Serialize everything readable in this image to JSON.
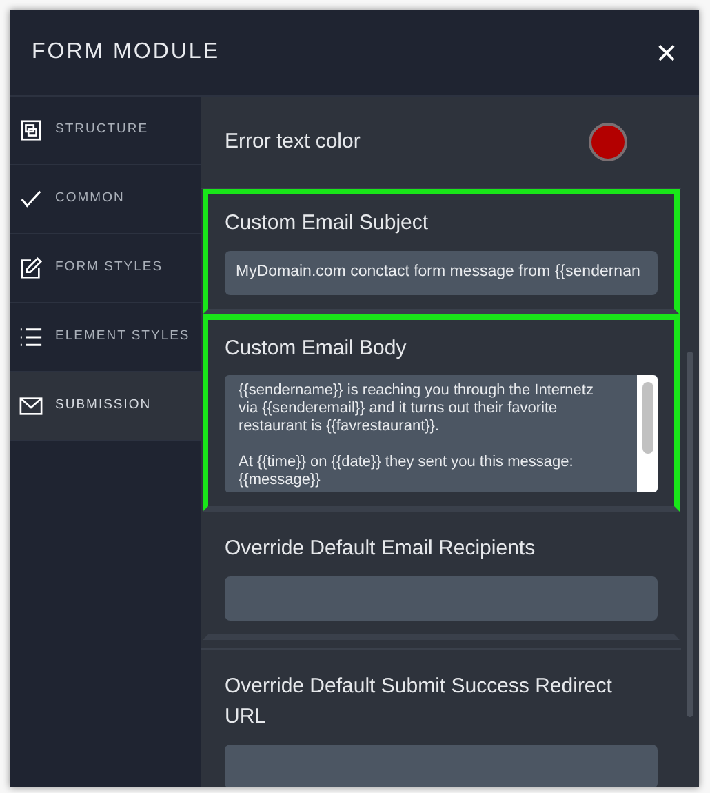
{
  "window": {
    "title": "FORM MODULE",
    "close": "×"
  },
  "sidebar": {
    "items": [
      {
        "label": "STRUCTURE",
        "selected": false
      },
      {
        "label": "COMMON",
        "selected": false
      },
      {
        "label": "FORM STYLES",
        "selected": false
      },
      {
        "label": "ELEMENT STYLES",
        "selected": false
      },
      {
        "label": "SUBMISSION",
        "selected": true
      }
    ]
  },
  "settings": [
    {
      "kind": "color",
      "label": "Error text color",
      "color": "#b30000"
    },
    {
      "kind": "input",
      "label": "Custom Email Subject",
      "value": "MyDomain.com conctact form message from {{sendernan",
      "highlighted": true
    },
    {
      "kind": "textarea",
      "label": "Custom Email Body",
      "value": "{{sendername}} is reaching you through the Internetz\nvia {{senderemail}} and it turns out their favorite\nrestaurant is {{favrestaurant}}.\n\nAt {{time}} on {{date}} they sent you this message:\n{{message}}",
      "highlighted": true
    },
    {
      "kind": "input",
      "label": "Override Default Email Recipients",
      "highlighted": false
    },
    {
      "kind": "input",
      "label": "Override Default Submit Success Redirect URL",
      "highlighted": false
    }
  ]
}
